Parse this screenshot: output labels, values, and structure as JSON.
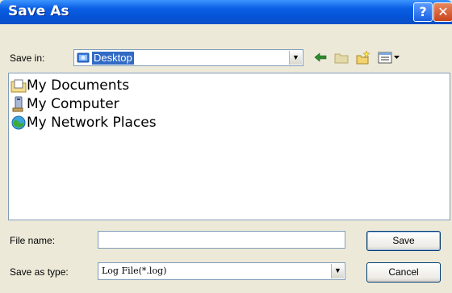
{
  "window": {
    "title": "Save As"
  },
  "titlebar": {
    "help_glyph": "?",
    "close_glyph": "✕"
  },
  "save_in": {
    "label": "Save in:",
    "value": "Desktop"
  },
  "toolbar": {
    "icons": [
      "back-arrow-icon",
      "up-folder-icon",
      "new-folder-icon",
      "view-menu-icon"
    ]
  },
  "files": [
    {
      "name": "My Documents",
      "icon": "my-documents-icon"
    },
    {
      "name": "My Computer",
      "icon": "my-computer-icon"
    },
    {
      "name": "My Network Places",
      "icon": "network-places-icon"
    }
  ],
  "file_name": {
    "label": "File name:",
    "value": ""
  },
  "save_as_type": {
    "label": "Save as type:",
    "value": "Log File(*.log)"
  },
  "buttons": {
    "save": "Save",
    "cancel": "Cancel"
  },
  "colors": {
    "titlebar": "#0553d6",
    "selection": "#316ac5",
    "face": "#ece9d8"
  }
}
